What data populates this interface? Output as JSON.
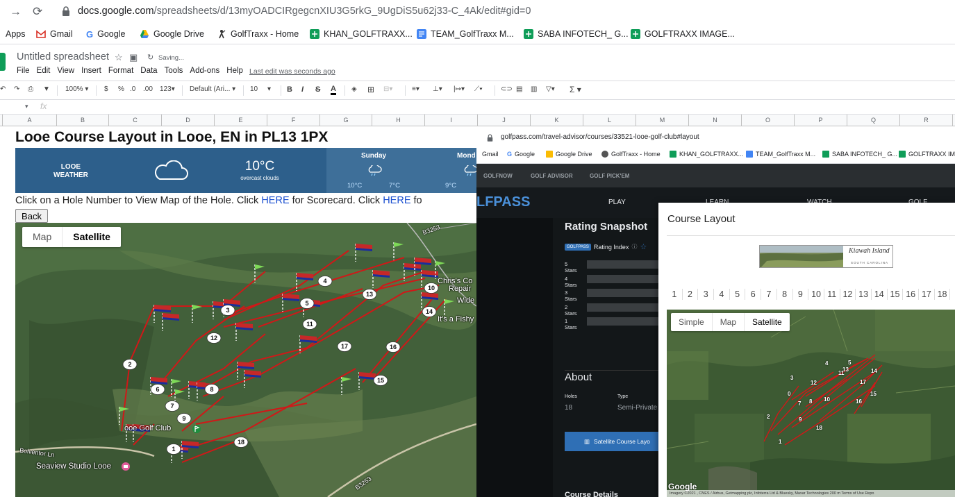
{
  "browser": {
    "url_domain": "docs.google.com",
    "url_path": "/spreadsheets/d/13myOADCIRgegcnXIU3G5rkG_9UgDiS5u62j33-C_4Ak/edit#gid=0",
    "bookmarks": [
      {
        "label": "Apps",
        "icon": "apps-grid-icon"
      },
      {
        "label": "Gmail",
        "icon": "gmail-icon"
      },
      {
        "label": "Google",
        "icon": "google-icon"
      },
      {
        "label": "Google Drive",
        "icon": "drive-icon"
      },
      {
        "label": "GolfTraxx - Home",
        "icon": "golfer-icon"
      },
      {
        "label": "KHAN_GOLFTRAXX...",
        "icon": "sheets-icon"
      },
      {
        "label": "TEAM_GolfTraxx M...",
        "icon": "docs-icon"
      },
      {
        "label": "SABA INFOTECH_ G...",
        "icon": "sheets-icon"
      },
      {
        "label": "GOLFTRAXX IMAGE...",
        "icon": "sheets-icon"
      }
    ]
  },
  "sheets": {
    "title": "Untitled spreadsheet",
    "saving": "Saving...",
    "menu": [
      "File",
      "Edit",
      "View",
      "Insert",
      "Format",
      "Data",
      "Tools",
      "Add-ons",
      "Help"
    ],
    "last_edit": "Last edit was seconds ago",
    "toolbar": {
      "zoom": "100%",
      "currency": "$",
      "percent": "%",
      "dec_dec": ".0",
      "dec_inc": ".00",
      "format": "123",
      "font": "Default (Ari...",
      "size": "10"
    },
    "columns": [
      "A",
      "B",
      "C",
      "D",
      "E",
      "F",
      "G",
      "H",
      "I",
      "J",
      "K",
      "L",
      "M",
      "N",
      "O",
      "P",
      "Q",
      "R"
    ]
  },
  "looe": {
    "title": "Looe Course Layout in Looe, EN in PL13 1PX",
    "weather": {
      "location_line1": "LOOE",
      "location_line2": "WEATHER",
      "temp": "10°C",
      "condition": "overcast clouds",
      "day1": "Sunday",
      "day1_high": "10°C",
      "day1_low": "7°C",
      "day2": "Mond",
      "day2_high": "9°C"
    },
    "instructions_pre": "Click on a Hole Number to View Map of the Hole. Click ",
    "link_here": "HERE",
    "instructions_mid": " for Scorecard. Click ",
    "instructions_post": " fo",
    "back": "Back",
    "map_toggle": {
      "map": "Map",
      "satellite": "Satellite"
    },
    "labels": {
      "golf_club": "ooe Golf Club",
      "studio": "Seaview Studio Looe",
      "chris_1": "Chris's Co",
      "chris_2": "Repair",
      "wide": "Wide",
      "fishy": "It's a Fishy",
      "road_1": "B3253",
      "road_2": "B3253",
      "road_3": "Bolventor Ln"
    },
    "holes": [
      "1",
      "2",
      "3",
      "4",
      "5",
      "6",
      "7",
      "8",
      "9",
      "10",
      "11",
      "12",
      "13",
      "14",
      "15",
      "16",
      "17",
      "18"
    ]
  },
  "golfpass": {
    "url": "golfpass.com/travel-advisor/courses/33521-looe-golf-club#layout",
    "bookmarks": [
      "Gmail",
      "Google",
      "Google Drive",
      "GolfTraxx - Home",
      "KHAN_GOLFTRAXX...",
      "TEAM_GolfTraxx M...",
      "SABA INFOTECH_ G...",
      "GOLFTRAXX IMA"
    ],
    "topnav": [
      "GOLFNOW",
      "GOLF ADVISOR",
      "GOLF PICK'EM"
    ],
    "logo": "LFPASS",
    "mainnav": [
      "PLAY",
      "LEARN",
      "WATCH",
      "GOLF ADVISOR"
    ],
    "rating_title": "Rating Snapshot",
    "rating_badge": "GOLFPASS",
    "rating_index": "Rating Index",
    "stars": [
      "5 Stars",
      "4 Stars",
      "3 Stars",
      "2 Stars",
      "1 Stars"
    ],
    "about": "About",
    "holes_label": "Holes",
    "holes_value": "18",
    "type_label": "Type",
    "type_value": "Semi-Private",
    "sat_button": "Satellite Course Layo",
    "course_details": "Course Details"
  },
  "popup": {
    "title": "Course Layout",
    "banner_text": "Kiawah Island",
    "banner_sub": "SOUTH CAROLINA",
    "hole_tabs": [
      "1",
      "2",
      "3",
      "4",
      "5",
      "6",
      "7",
      "8",
      "9",
      "10",
      "11",
      "12",
      "13",
      "14",
      "15",
      "16",
      "17",
      "18"
    ],
    "map_toggle": {
      "simple": "Simple",
      "map": "Map",
      "satellite": "Satellite"
    },
    "google": "Google",
    "attribution": "Imagery ©2021 , CNES / Airbus, Getmapping plc, Infoterra Ltd & Bluesky, Maxar Technologies   200 m   Terms of Use   Repo",
    "map_numbers": [
      "4",
      "5",
      "13",
      "11",
      "14",
      "3",
      "12",
      "17",
      "0",
      "7",
      "8",
      "10",
      "15",
      "16",
      "2",
      "9",
      "18",
      "1"
    ]
  },
  "colors": {
    "sheets_green": "#0f9d58",
    "weather_blue": "#2d5f8b",
    "link_blue": "#1a4fd0",
    "golfpass_dark": "#121619",
    "route_red": "#d01818"
  }
}
